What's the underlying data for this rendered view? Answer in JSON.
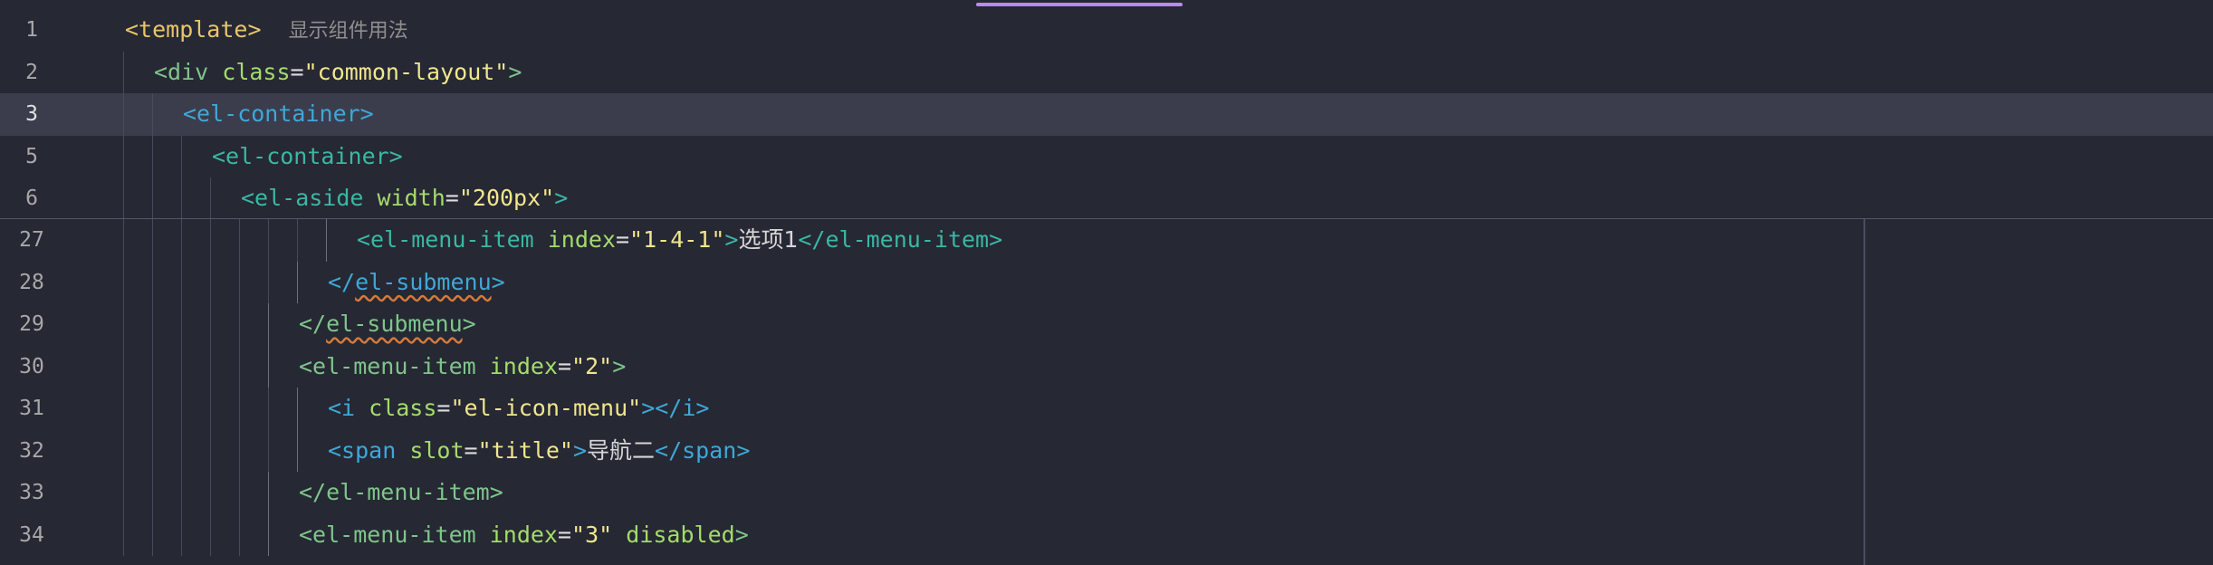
{
  "editor": {
    "sticky_lines": [
      {
        "number": "1",
        "indent": 0,
        "tokens": [
          {
            "text": "<template>",
            "style": "tag-yellow"
          },
          {
            "text": "  ",
            "style": "text"
          },
          {
            "text": "显示组件用法",
            "style": "comment"
          }
        ]
      },
      {
        "number": "2",
        "indent": 1,
        "tokens": [
          {
            "text": "<div ",
            "style": "tag-green"
          },
          {
            "text": "class",
            "style": "attr"
          },
          {
            "text": "=",
            "style": "text"
          },
          {
            "text": "\"common-layout\"",
            "style": "str"
          },
          {
            "text": ">",
            "style": "tag-green"
          }
        ]
      },
      {
        "number": "3",
        "indent": 2,
        "current": true,
        "tokens": [
          {
            "text": "<el-container>",
            "style": "tag-blue"
          }
        ]
      },
      {
        "number": "5",
        "indent": 3,
        "tokens": [
          {
            "text": "<el-container>",
            "style": "tag-teal"
          }
        ]
      },
      {
        "number": "6",
        "indent": 4,
        "tokens": [
          {
            "text": "<el-aside ",
            "style": "tag-teal"
          },
          {
            "text": "width",
            "style": "attr"
          },
          {
            "text": "=",
            "style": "text"
          },
          {
            "text": "\"200px\"",
            "style": "str"
          },
          {
            "text": ">",
            "style": "tag-teal"
          }
        ]
      }
    ],
    "lines": [
      {
        "number": "27",
        "indent": 8,
        "tokens": [
          {
            "text": "<el-menu-item ",
            "style": "tag-teal"
          },
          {
            "text": "index",
            "style": "attr"
          },
          {
            "text": "=",
            "style": "text"
          },
          {
            "text": "\"1-4-1\"",
            "style": "str"
          },
          {
            "text": ">",
            "style": "tag-teal"
          },
          {
            "text": "选项1",
            "style": "cjk"
          },
          {
            "text": "</el-menu-item>",
            "style": "tag-teal"
          }
        ]
      },
      {
        "number": "28",
        "indent": 7,
        "tokens": [
          {
            "text": "</",
            "style": "tag-blue"
          },
          {
            "text": "el-submenu",
            "style": "tag-blue",
            "squiggle": true
          },
          {
            "text": ">",
            "style": "tag-blue"
          }
        ]
      },
      {
        "number": "29",
        "indent": 6,
        "tokens": [
          {
            "text": "</",
            "style": "tag-green"
          },
          {
            "text": "el-submenu",
            "style": "tag-green",
            "squiggle": true
          },
          {
            "text": ">",
            "style": "tag-green"
          }
        ]
      },
      {
        "number": "30",
        "indent": 6,
        "tokens": [
          {
            "text": "<el-menu-item ",
            "style": "tag-green"
          },
          {
            "text": "index",
            "style": "attr"
          },
          {
            "text": "=",
            "style": "text"
          },
          {
            "text": "\"2\"",
            "style": "str"
          },
          {
            "text": ">",
            "style": "tag-green"
          }
        ]
      },
      {
        "number": "31",
        "indent": 7,
        "tokens": [
          {
            "text": "<i ",
            "style": "tag-blue"
          },
          {
            "text": "class",
            "style": "attr"
          },
          {
            "text": "=",
            "style": "text"
          },
          {
            "text": "\"el-icon-menu\"",
            "style": "str"
          },
          {
            "text": "></i>",
            "style": "tag-blue"
          }
        ]
      },
      {
        "number": "32",
        "indent": 7,
        "tokens": [
          {
            "text": "<span ",
            "style": "tag-blue"
          },
          {
            "text": "slot",
            "style": "attr"
          },
          {
            "text": "=",
            "style": "text"
          },
          {
            "text": "\"title\"",
            "style": "str"
          },
          {
            "text": ">",
            "style": "tag-blue"
          },
          {
            "text": "导航二",
            "style": "cjk"
          },
          {
            "text": "</span>",
            "style": "tag-blue"
          }
        ]
      },
      {
        "number": "33",
        "indent": 6,
        "tokens": [
          {
            "text": "</el-menu-item>",
            "style": "tag-green"
          }
        ]
      },
      {
        "number": "34",
        "indent": 6,
        "tokens": [
          {
            "text": "<el-menu-item ",
            "style": "tag-green"
          },
          {
            "text": "index",
            "style": "attr"
          },
          {
            "text": "=",
            "style": "text"
          },
          {
            "text": "\"3\"",
            "style": "str"
          },
          {
            "text": " ",
            "style": "text"
          },
          {
            "text": "disabled",
            "style": "attr"
          },
          {
            "text": ">",
            "style": "tag-green"
          }
        ]
      }
    ]
  }
}
